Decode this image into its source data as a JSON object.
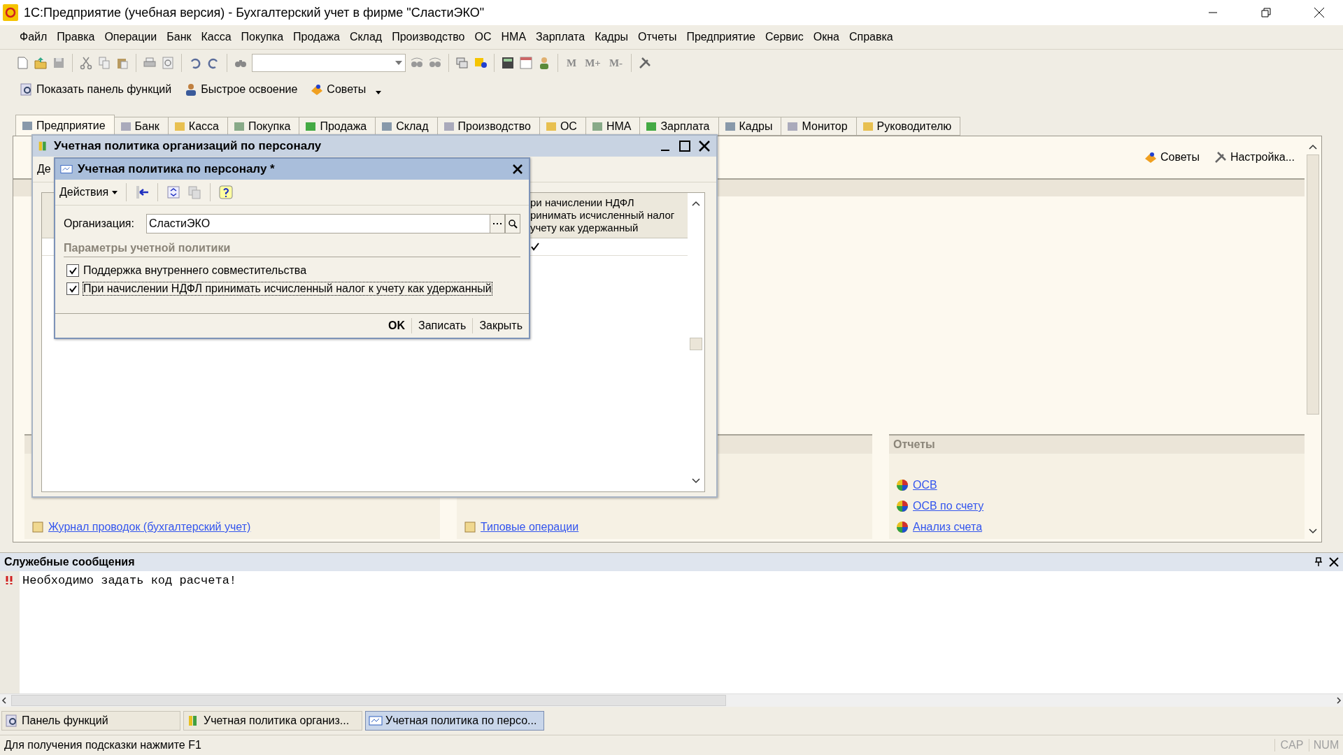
{
  "window": {
    "title": "1С:Предприятие (учебная версия) - Бухгалтерский учет в фирме \"СластиЭКО\""
  },
  "menu": [
    "Файл",
    "Правка",
    "Операции",
    "Банк",
    "Касса",
    "Покупка",
    "Продажа",
    "Склад",
    "Производство",
    "ОС",
    "НМА",
    "Зарплата",
    "Кадры",
    "Отчеты",
    "Предприятие",
    "Сервис",
    "Окна",
    "Справка"
  ],
  "memory_buttons": [
    "M",
    "M+",
    "M-"
  ],
  "quick_toolbar": [
    "Показать панель функций",
    "Быстрое освоение",
    "Советы"
  ],
  "tabs": [
    {
      "label": "Предприятие",
      "selected": true
    },
    {
      "label": "Банк",
      "selected": false
    },
    {
      "label": "Касса",
      "selected": false
    },
    {
      "label": "Покупка",
      "selected": false
    },
    {
      "label": "Продажа",
      "selected": false
    },
    {
      "label": "Склад",
      "selected": false
    },
    {
      "label": "Производство",
      "selected": false
    },
    {
      "label": "ОС",
      "selected": false
    },
    {
      "label": "НМА",
      "selected": false
    },
    {
      "label": "Зарплата",
      "selected": false
    },
    {
      "label": "Кадры",
      "selected": false
    },
    {
      "label": "Монитор",
      "selected": false
    },
    {
      "label": "Руководителю",
      "selected": false
    }
  ],
  "function_panel": {
    "actions": [
      "Советы",
      "Настройка..."
    ],
    "groups": [
      {
        "links": [
          "Журнал проводок (бухгалтерский учет)"
        ]
      },
      {
        "links": [
          "Типовые операции"
        ]
      },
      {
        "title": "Отчеты",
        "links": [
          "ОСВ",
          "ОСВ по счету",
          "Анализ счета"
        ]
      }
    ]
  },
  "list_window": {
    "title": "Учетная политика организаций по персоналу",
    "toolbar_fragment": "Де",
    "column_2_header": [
      "ри начислении НДФЛ",
      "ринимать исчисленный налог",
      "учету как удержанный"
    ],
    "rows": [
      {
        "checked": true
      }
    ]
  },
  "dialog": {
    "title": "Учетная политика по персоналу *",
    "actions_menu": "Действия",
    "organization": {
      "label": "Организация:",
      "value": "СластиЭКО"
    },
    "section": "Параметры учетной политики",
    "options": [
      {
        "label": "Поддержка внутреннего совместительства",
        "checked": true,
        "focused": false
      },
      {
        "label": "При начислении НДФЛ принимать исчисленный налог к учету как удержанный",
        "checked": true,
        "focused": true
      }
    ],
    "buttons": [
      {
        "label": "OK",
        "default": true
      },
      {
        "label": "Записать",
        "default": false
      },
      {
        "label": "Закрыть",
        "default": false
      }
    ]
  },
  "messages": {
    "title": "Служебные сообщения",
    "items": [
      {
        "text": "Необходимо задать код расчета!"
      }
    ]
  },
  "taskbar": [
    {
      "label": "Панель функций",
      "selected": false
    },
    {
      "label": "Учетная политика организ...",
      "selected": false
    },
    {
      "label": "Учетная политика по персо...",
      "selected": true
    }
  ],
  "status_bar": {
    "hint": "Для получения подсказки нажмите F1",
    "indicators": [
      "CAP",
      "NUM"
    ]
  }
}
